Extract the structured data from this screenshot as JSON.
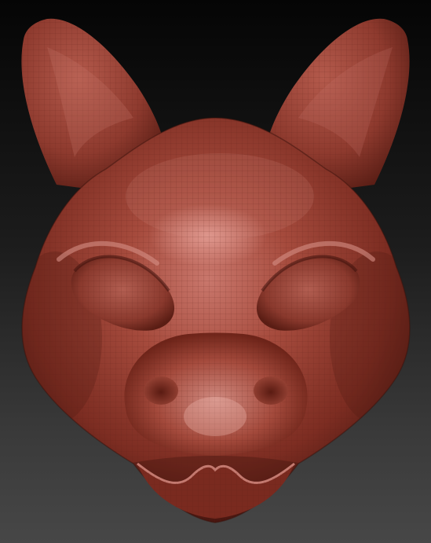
{
  "scene": {
    "subject": "sculpted-creature-mask",
    "colors": {
      "background_top": "#050505",
      "background_bottom": "#474747",
      "clay_base": "#9a4033",
      "clay_highlight": "#d9928a",
      "clay_shadow": "#4a1710",
      "wire": "#7a2f25"
    }
  }
}
